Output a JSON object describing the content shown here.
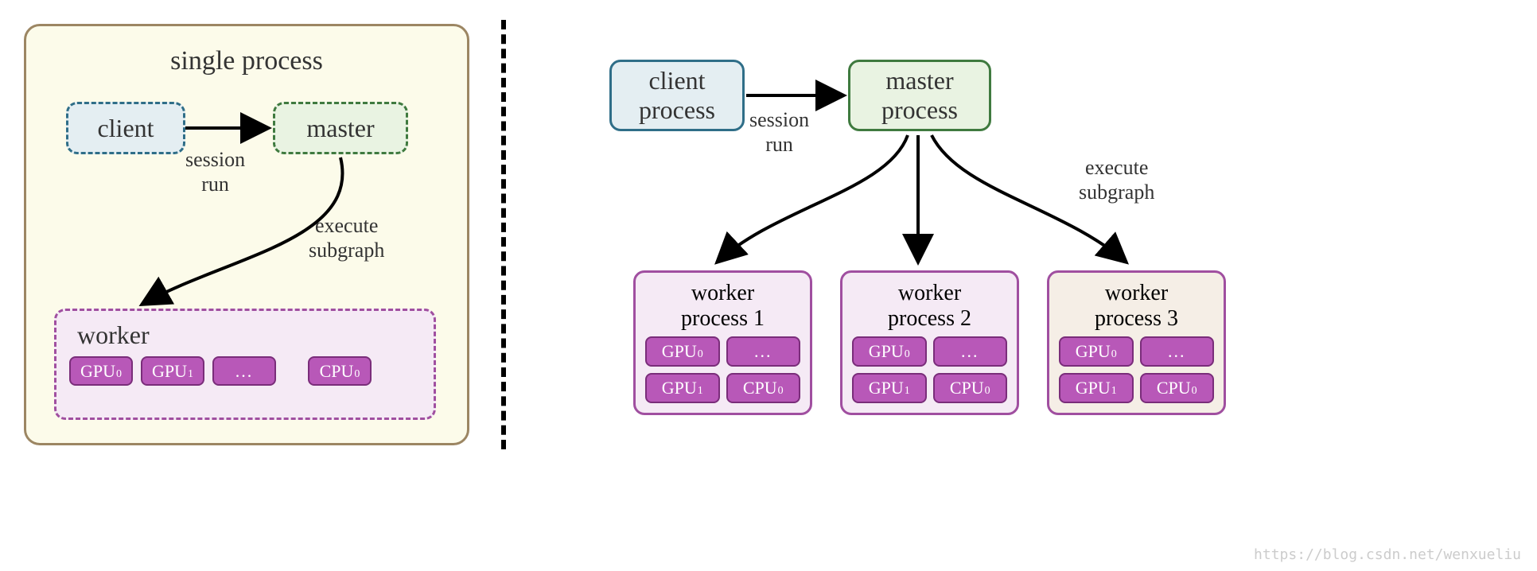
{
  "left": {
    "title": "single process",
    "client_label": "client",
    "master_label": "master",
    "worker_label": "worker",
    "session_label": "session\nrun",
    "execute_label": "execute\nsubgraph",
    "chips": {
      "gpu0": "GPU",
      "gpu0_sub": "0",
      "gpu1": "GPU",
      "gpu1_sub": "1",
      "dots": "...",
      "cpu0": "CPU",
      "cpu0_sub": "0"
    }
  },
  "right": {
    "client_label": "client\nprocess",
    "master_label": "master\nprocess",
    "session_label": "session\nrun",
    "execute_label": "execute\nsubgraph",
    "workers": [
      {
        "title": "worker\nprocess 1"
      },
      {
        "title": "worker\nprocess 2"
      },
      {
        "title": "worker\nprocess 3"
      }
    ],
    "chips": {
      "gpu0": "GPU",
      "gpu0_sub": "0",
      "gpu1": "GPU",
      "gpu1_sub": "1",
      "dots": "...",
      "cpu0": "CPU",
      "cpu0_sub": "0"
    }
  },
  "watermark": "https://blog.csdn.net/wenxueliu"
}
